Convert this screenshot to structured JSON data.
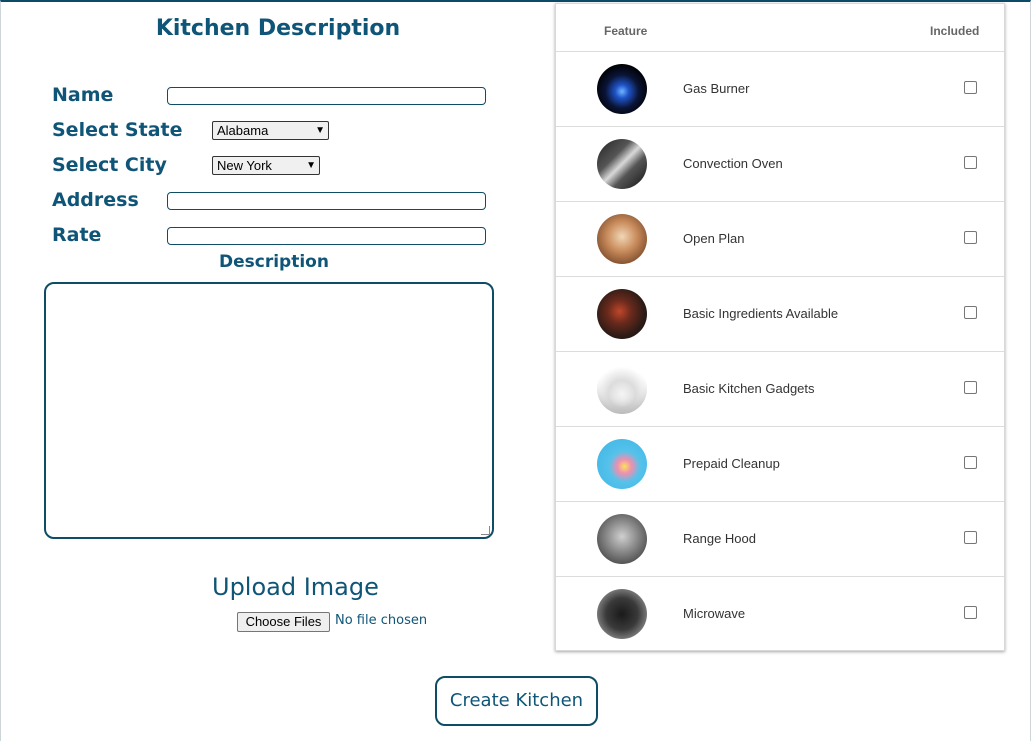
{
  "form": {
    "title": "Kitchen Description",
    "name_label": "Name",
    "name_value": "",
    "state_label": "Select State",
    "state_value": "Alabama",
    "city_label": "Select City",
    "city_value": "New York",
    "address_label": "Address",
    "address_value": "",
    "rate_label": "Rate",
    "rate_value": "",
    "description_label": "Description",
    "description_value": "",
    "upload_label": "Upload Image",
    "choose_files_label": "Choose Files",
    "file_status": "No file chosen",
    "create_button_label": "Create Kitchen"
  },
  "features": {
    "header_feature": "Feature",
    "header_included": "Included",
    "items": [
      {
        "label": "Gas Burner",
        "icon": "gas-burner-photo",
        "checked": false
      },
      {
        "label": "Convection Oven",
        "icon": "convection-oven-photo",
        "checked": false
      },
      {
        "label": "Open Plan",
        "icon": "open-plan-photo",
        "checked": false
      },
      {
        "label": "Basic Ingredients Available",
        "icon": "ingredients-photo",
        "checked": false
      },
      {
        "label": "Basic Kitchen Gadgets",
        "icon": "kitchen-gadgets-photo",
        "checked": false
      },
      {
        "label": "Prepaid Cleanup",
        "icon": "cleanup-photo",
        "checked": false
      },
      {
        "label": "Range Hood",
        "icon": "range-hood-photo",
        "checked": false
      },
      {
        "label": "Microwave",
        "icon": "microwave-photo",
        "checked": false
      }
    ]
  },
  "colors": {
    "accent": "#0f5577",
    "border": "#0f4d66"
  }
}
